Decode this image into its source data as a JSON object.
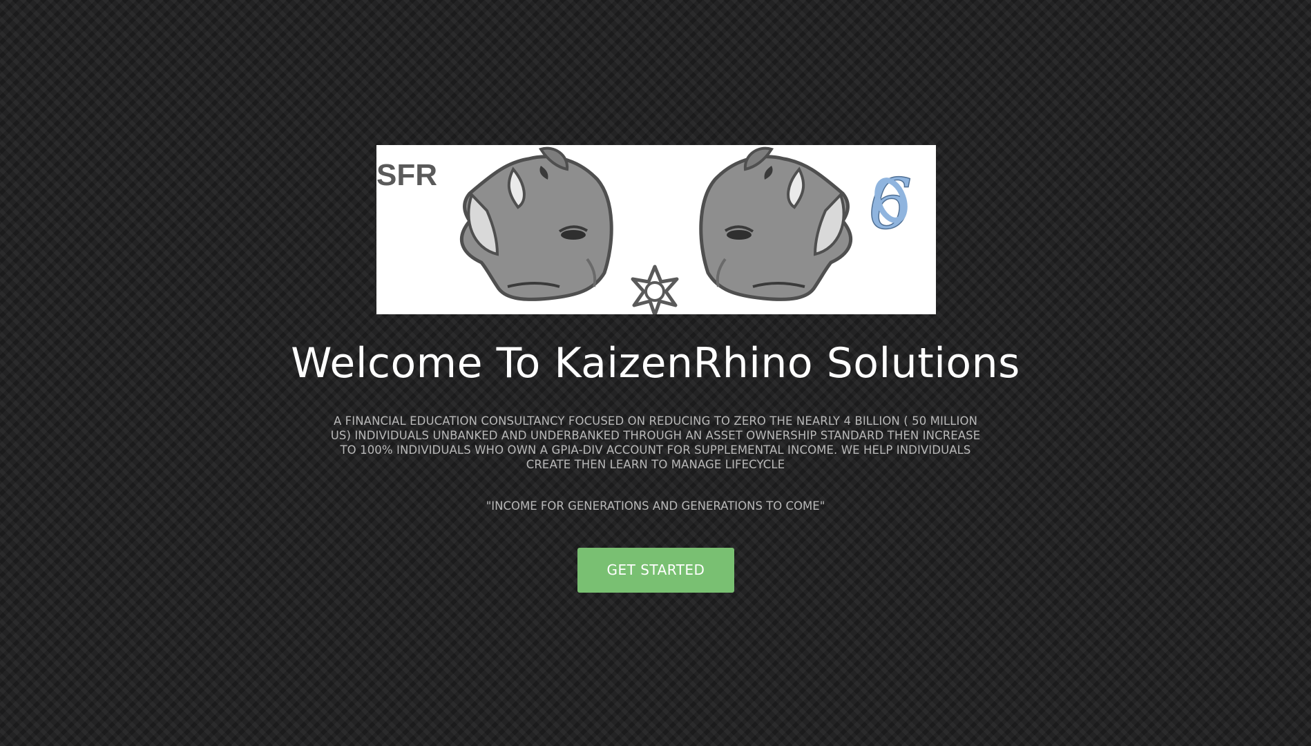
{
  "logo": {
    "left_text": "SFR",
    "right_text": "6"
  },
  "hero": {
    "title": "Welcome To KaizenRhino Solutions",
    "description": "A FINANCIAL EDUCATION CONSULTANCY FOCUSED ON REDUCING TO ZERO THE NEARLY 4 BILLION ( 50 MILLION US) INDIVIDUALS UNBANKED AND UNDERBANKED THROUGH AN ASSET OWNERSHIP STANDARD THEN INCREASE TO 100% INDIVIDUALS WHO OWN A GPIA-DIV ACCOUNT FOR SUPPLEMENTAL INCOME. WE HELP INDIVIDUALS CREATE THEN LEARN TO MANAGE LIFECYCLE",
    "tagline": "\"INCOME FOR GENERATIONS AND GENERATIONS TO COME\"",
    "cta_label": "GET STARTED"
  },
  "colors": {
    "background": "#232324",
    "cta": "#79c072",
    "text_muted": "#b9b9b9",
    "logo_blue": "#8fb4de"
  }
}
